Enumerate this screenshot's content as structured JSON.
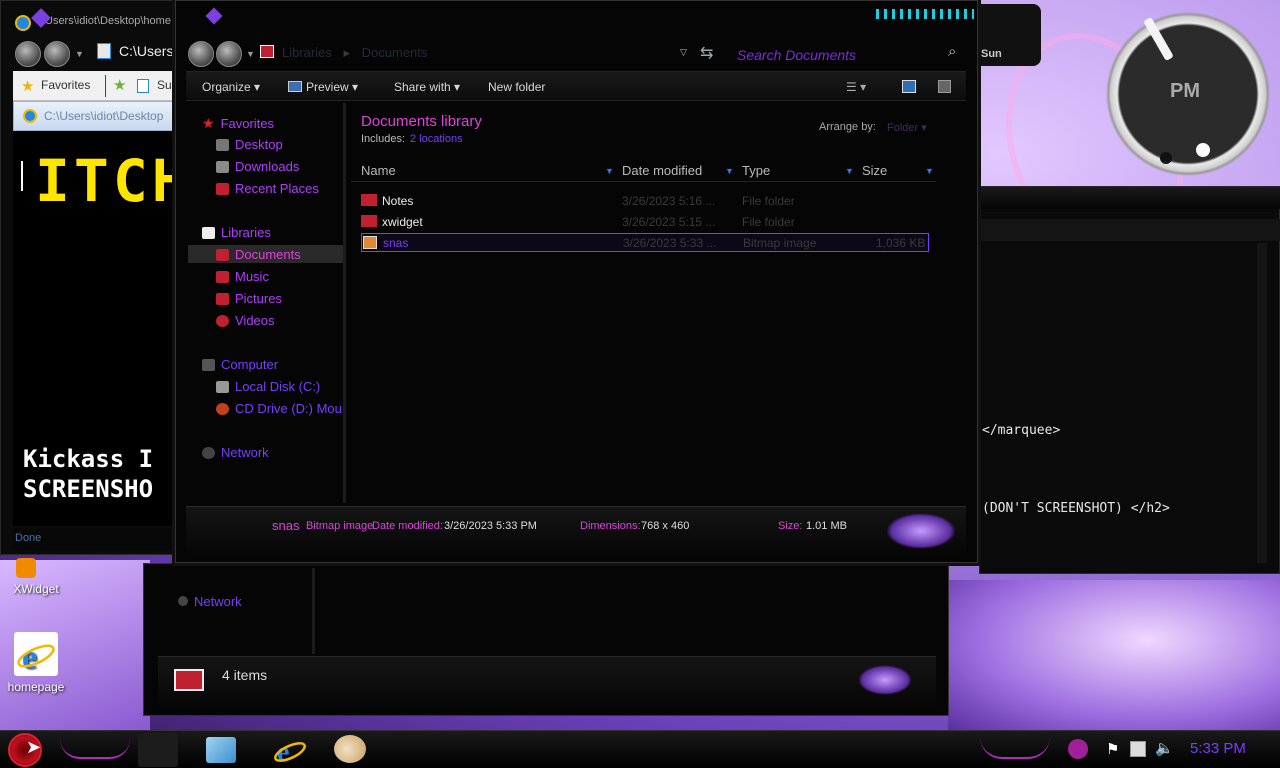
{
  "desktop": {
    "icons": [
      {
        "label": "XWidget"
      },
      {
        "label": "homepage"
      }
    ]
  },
  "ie_window": {
    "title": "Users\\idiot\\Desktop\\home",
    "address": "C:\\Users\\",
    "favorites_label": "Favorites",
    "favbar_extra": "Su",
    "tab_label": "C:\\Users\\idiot\\Desktop",
    "page_heading": "ITCH",
    "page_line1": "Kickass I",
    "page_line2": "SCREENSHO",
    "status": "Done"
  },
  "explorer": {
    "breadcrumb": [
      "Libraries",
      "Documents"
    ],
    "search_placeholder": "Search Documents",
    "toolbar": {
      "organize": "Organize",
      "preview": "Preview",
      "share_with": "Share with",
      "new_folder": "New folder"
    },
    "nav": {
      "favorites": "Favorites",
      "desktop": "Desktop",
      "downloads": "Downloads",
      "recent_places": "Recent Places",
      "libraries": "Libraries",
      "documents": "Documents",
      "music": "Music",
      "pictures": "Pictures",
      "videos": "Videos",
      "computer": "Computer",
      "local_disk": "Local Disk (C:)",
      "cd_drive": "CD Drive (D:) Mou",
      "network": "Network"
    },
    "library_title": "Documents library",
    "includes_label": "Includes:",
    "includes_link": "2 locations",
    "arrange_by_label": "Arrange by:",
    "arrange_by_value": "Folder",
    "columns": {
      "name": "Name",
      "date_modified": "Date modified",
      "type": "Type",
      "size": "Size"
    },
    "files": [
      {
        "name": "Notes",
        "date": "3/26/2023 5:16 ...",
        "type": "File folder",
        "size": ""
      },
      {
        "name": "xwidget",
        "date": "3/26/2023 5:15 ...",
        "type": "File folder",
        "size": ""
      },
      {
        "name": "snas",
        "date": "3/26/2023 5:33 ...",
        "type": "Bitmap image",
        "size": "1,036 KB"
      }
    ],
    "details": {
      "name": "snas",
      "type_label": "Bitmap image",
      "date_label": "Date modified:",
      "date_value": "3/26/2023 5:33 PM",
      "dim_label": "Dimensions:",
      "dim_value": "768 x 460",
      "size_label": "Size:",
      "size_value": "1.01 MB"
    }
  },
  "explorer2": {
    "network": "Network",
    "items_count": "4 items"
  },
  "right_panel": {
    "line1": "</marquee>",
    "line2": "(DON'T SCREENSHOT) </h2>",
    "sun_label": "Sun"
  },
  "clock": {
    "ampm": "PM"
  },
  "taskbar": {
    "time": "5:33 PM"
  },
  "colors": {
    "accent_purple": "#9b30ff",
    "accent_magenta": "#e040e0",
    "link_blue": "#7a3cff"
  }
}
